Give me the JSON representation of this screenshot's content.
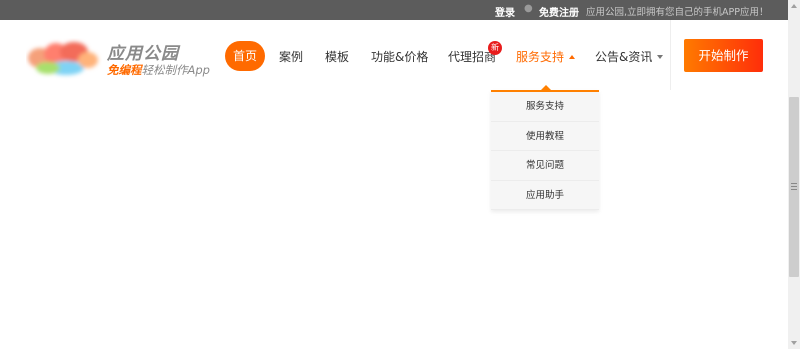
{
  "topbar": {
    "login": "登录",
    "separator": "●",
    "register": "免费注册",
    "slogan": "应用公园,立即拥有您自己的手机APP应用！"
  },
  "logo": {
    "title": "应用公园",
    "subtitle_highlight": "免编程",
    "subtitle_rest": "轻松制作App"
  },
  "nav": {
    "home": "首页",
    "cases": "案例",
    "templates": "模板",
    "features": "功能&价格",
    "agent": "代理招商",
    "agent_badge": "新",
    "service": "服务支持",
    "news": "公告&资讯",
    "start_button": "开始制作"
  },
  "dropdown": {
    "items": [
      "服务支持",
      "使用教程",
      "常见问题",
      "应用助手"
    ]
  },
  "colors": {
    "accent": "#ff6a00",
    "topbar_bg": "#5c5c5c",
    "badge": "#e81c1c"
  }
}
